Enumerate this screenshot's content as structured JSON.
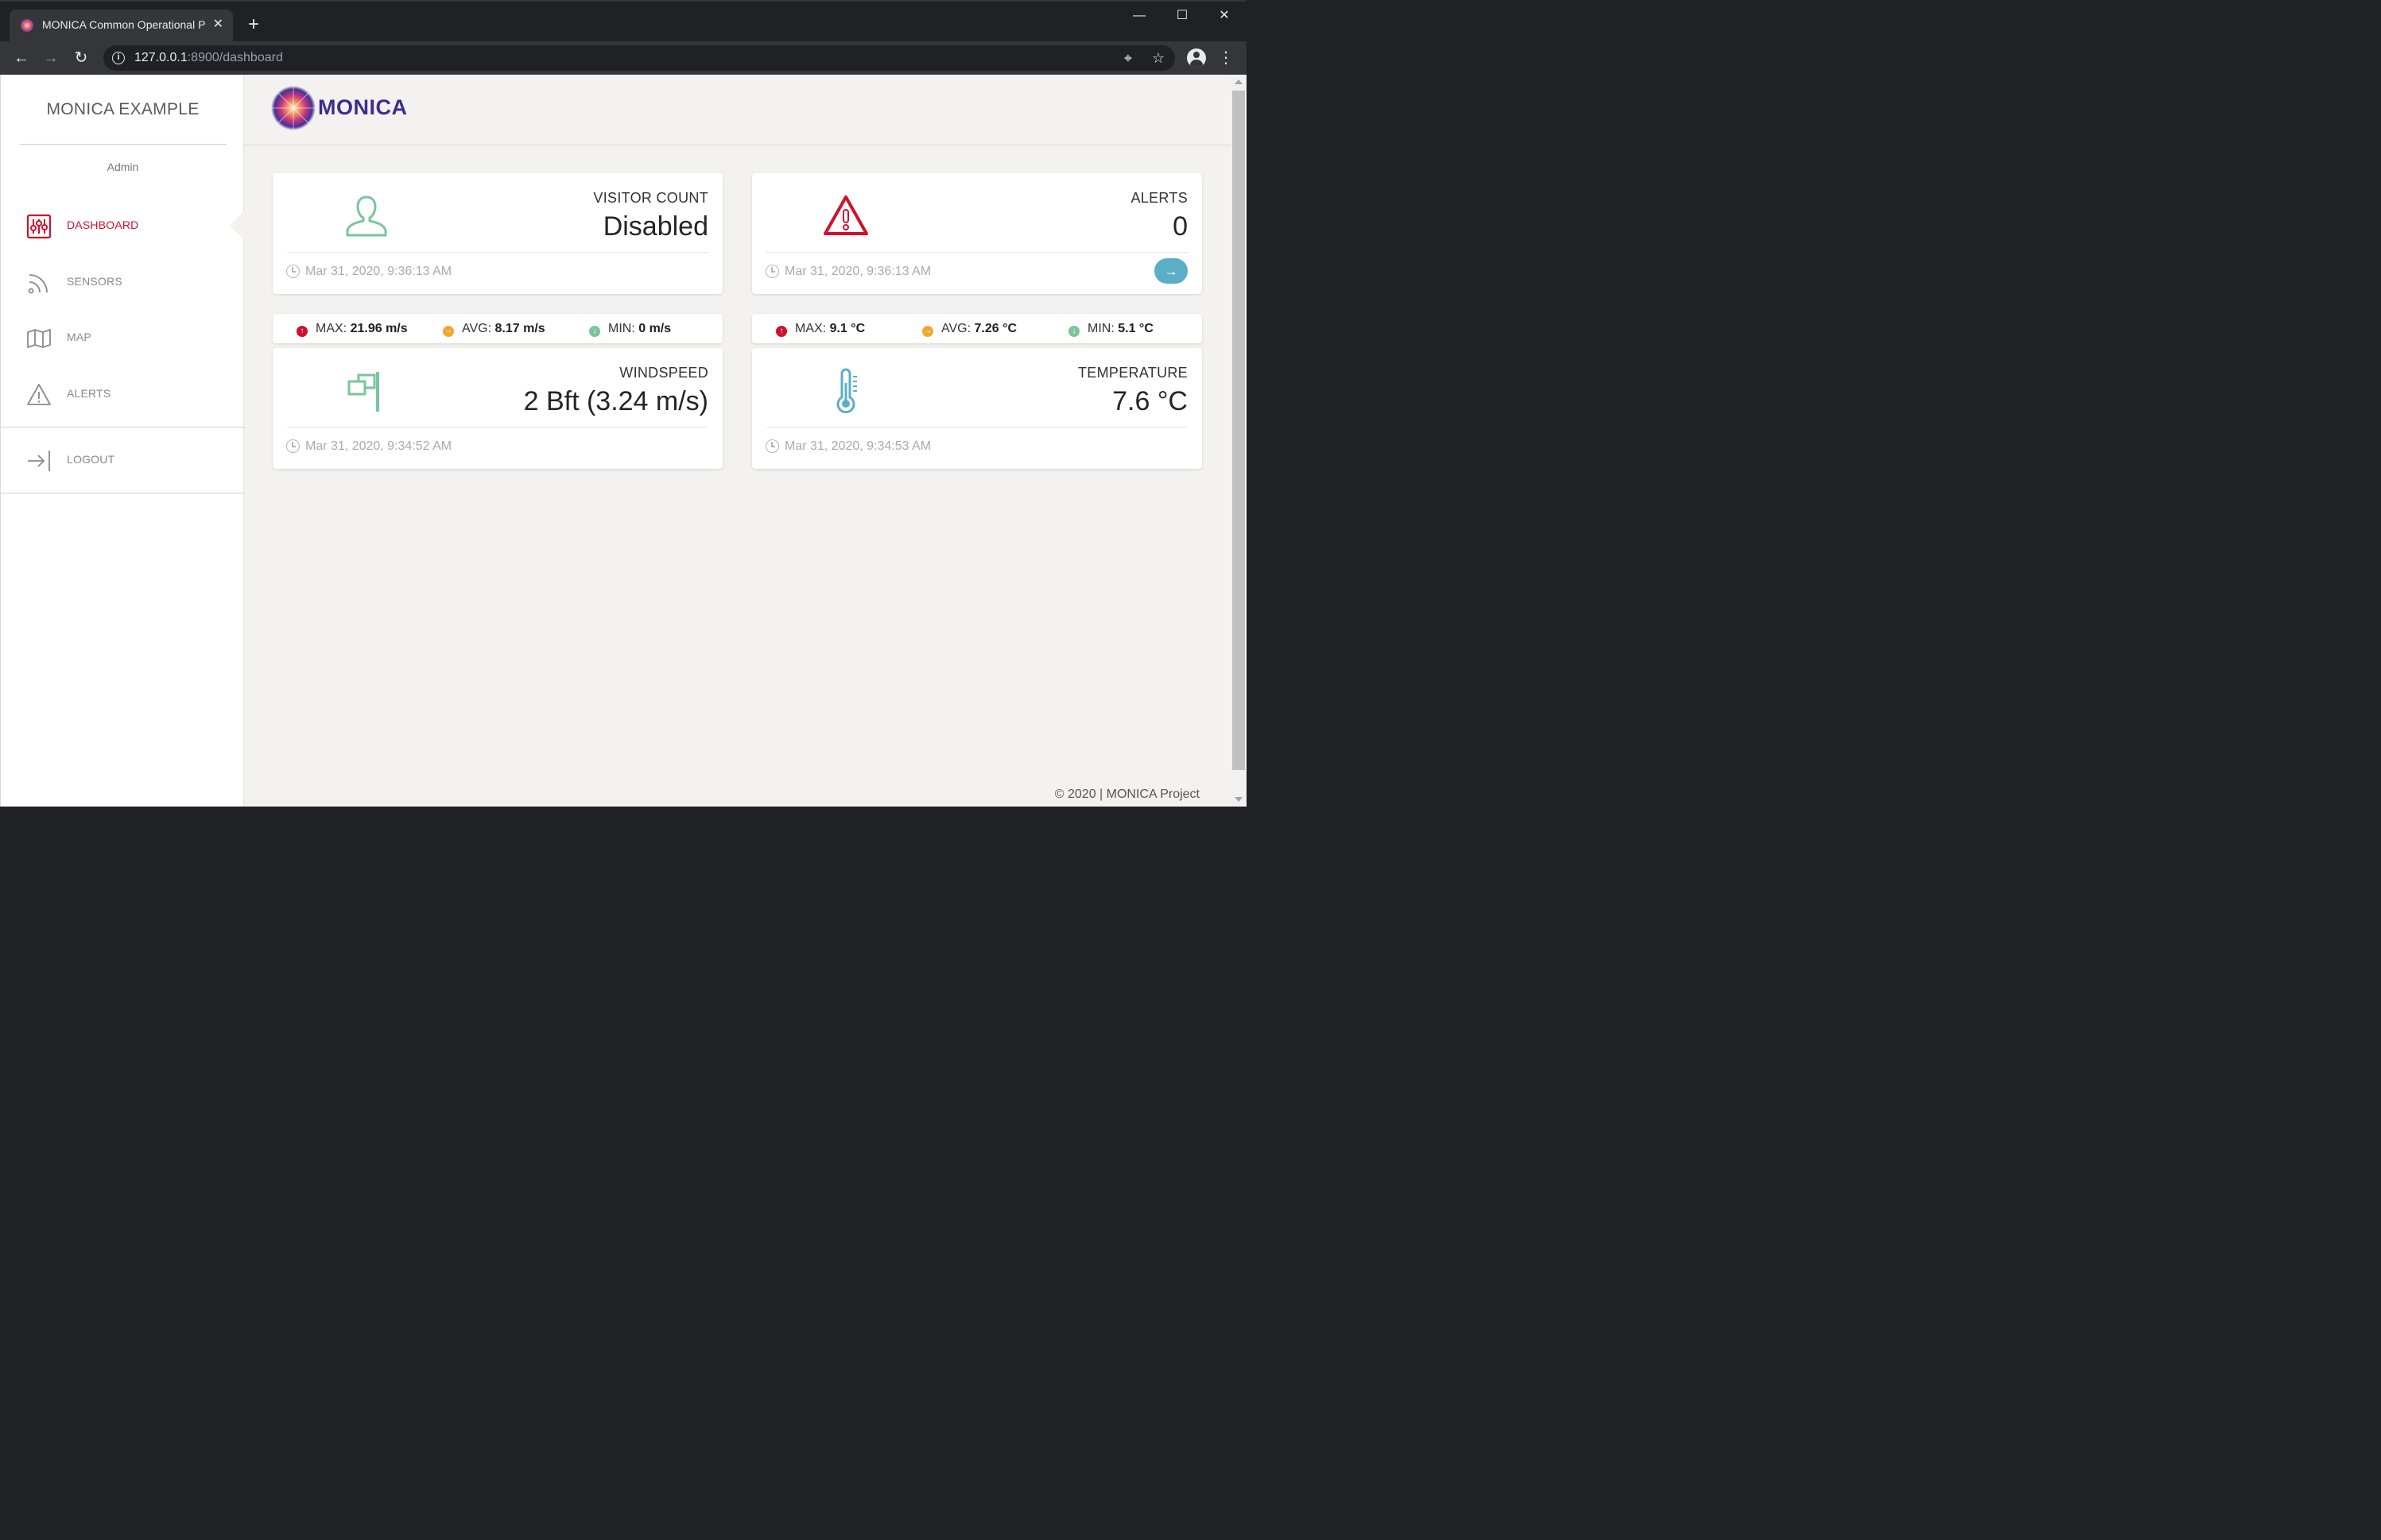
{
  "browser": {
    "tab_title": "MONICA Common Operational P",
    "tab_close": "✕",
    "new_tab": "+",
    "url_host": "127.0.0.1",
    "url_rest": ":8900/dashboard",
    "window_controls": {
      "minimize": "—",
      "maximize": "☐",
      "close": "✕"
    }
  },
  "sidebar": {
    "brand": "MONICA EXAMPLE",
    "user": "Admin",
    "items": [
      {
        "label": "DASHBOARD",
        "icon": "sliders-icon",
        "active": true
      },
      {
        "label": "SENSORS",
        "icon": "rss-icon",
        "active": false
      },
      {
        "label": "MAP",
        "icon": "map-icon",
        "active": false
      },
      {
        "label": "ALERTS",
        "icon": "warning-icon",
        "active": false
      }
    ],
    "logout": {
      "label": "LOGOUT",
      "icon": "logout-icon"
    }
  },
  "header": {
    "logo_text": "MONICA"
  },
  "cards": {
    "visitor": {
      "category": "VISITOR COUNT",
      "value": "Disabled",
      "time": "Mar 31, 2020, 9:36:13 AM"
    },
    "alerts": {
      "category": "ALERTS",
      "value": "0",
      "time": "Mar 31, 2020, 9:36:13 AM"
    },
    "wind": {
      "category": "WINDSPEED",
      "value": "2 Bft (3.24 m/s)",
      "time": "Mar 31, 2020, 9:34:52 AM"
    },
    "temperature": {
      "category": "TEMPERATURE",
      "value": "7.6 °C",
      "time": "Mar 31, 2020, 9:34:53 AM"
    }
  },
  "stats": {
    "wind": {
      "max_label": "MAX:",
      "max_value": "21.96 m/s",
      "avg_label": "AVG:",
      "avg_value": "8.17 m/s",
      "min_label": "MIN:",
      "min_value": "0 m/s"
    },
    "temperature": {
      "max_label": "MAX:",
      "max_value": "9.1 °C",
      "avg_label": "AVG:",
      "avg_value": "7.26 °C",
      "min_label": "MIN:",
      "min_value": "5.1 °C"
    }
  },
  "footer": "© 2020 | MONICA Project",
  "colors": {
    "accent_red": "#d0112b",
    "green": "#7ac59a",
    "blue": "#5aaec7",
    "amber": "#f0a830",
    "brand_purple": "#3b2e8c"
  }
}
